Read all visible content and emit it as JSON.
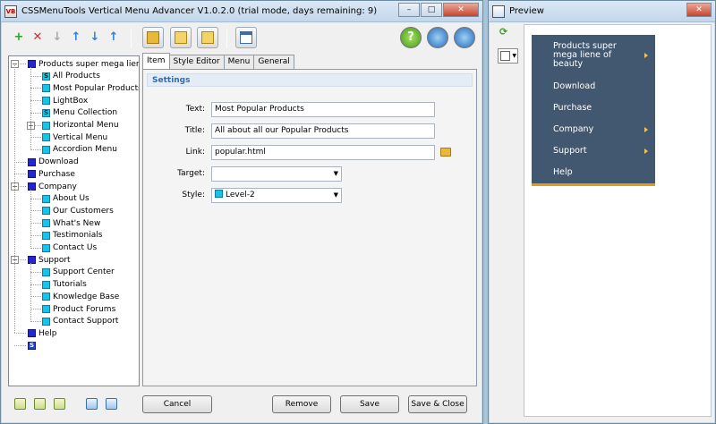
{
  "main": {
    "title": "CSSMenuTools Vertical Menu Advancer V1.0.2.0 (trial mode, days remaining: 9)",
    "app_icon_text": "VB"
  },
  "window_controls": {
    "minimize": "–",
    "maximize": "□",
    "close": "✕"
  },
  "toolbar": {
    "add": "+",
    "delete": "✕",
    "move_down_gray": "↓",
    "move_up": "↑",
    "move_down": "↓",
    "move_top": "↑",
    "help": "?"
  },
  "tree": {
    "items": [
      {
        "label": "Products super mega liene of",
        "icon": "dark",
        "level": 0,
        "expander": "−"
      },
      {
        "label": "All Products",
        "icon": "s2",
        "level": 1
      },
      {
        "label": "Most Popular Products",
        "icon": "cyan",
        "level": 1
      },
      {
        "label": "LightBox",
        "icon": "cyan",
        "level": 1
      },
      {
        "label": "Menu Collection",
        "icon": "s2",
        "level": 1
      },
      {
        "label": "Horizontal Menu",
        "icon": "cyan",
        "level": 1,
        "expander": "+"
      },
      {
        "label": "Vertical Menu",
        "icon": "cyan",
        "level": 1
      },
      {
        "label": "Accordion Menu",
        "icon": "cyan",
        "level": 1
      },
      {
        "label": "Download",
        "icon": "dark",
        "level": 0
      },
      {
        "label": "Purchase",
        "icon": "dark",
        "level": 0
      },
      {
        "label": "Company",
        "icon": "dark",
        "level": 0,
        "expander": "−"
      },
      {
        "label": "About Us",
        "icon": "cyan",
        "level": 1
      },
      {
        "label": "Our Customers",
        "icon": "cyan",
        "level": 1
      },
      {
        "label": "What's New",
        "icon": "cyan",
        "level": 1
      },
      {
        "label": "Testimonials",
        "icon": "cyan",
        "level": 1
      },
      {
        "label": "Contact Us",
        "icon": "cyan",
        "level": 1
      },
      {
        "label": "Support",
        "icon": "dark",
        "level": 0,
        "expander": "−"
      },
      {
        "label": "Support Center",
        "icon": "cyan",
        "level": 1
      },
      {
        "label": "Tutorials",
        "icon": "cyan",
        "level": 1
      },
      {
        "label": "Knowledge Base",
        "icon": "cyan",
        "level": 1
      },
      {
        "label": "Product Forums",
        "icon": "cyan",
        "level": 1
      },
      {
        "label": "Contact Support",
        "icon": "cyan",
        "level": 1
      },
      {
        "label": "Help",
        "icon": "dark",
        "level": 0
      },
      {
        "label": "",
        "icon": "s",
        "level": 0
      }
    ]
  },
  "tabs": [
    {
      "label": "Item",
      "active": true
    },
    {
      "label": "Style Editor"
    },
    {
      "label": "Menu"
    },
    {
      "label": "General"
    }
  ],
  "settings": {
    "header": "Settings",
    "text_label": "Text:",
    "text_value": "Most Popular Products",
    "title_label": "Title:",
    "title_value": "All about all  our Popular Products",
    "link_label": "Link:",
    "link_value": "popular.html",
    "target_label": "Target:",
    "target_value": "",
    "style_label": "Style:",
    "style_value": "Level-2"
  },
  "buttons": {
    "cancel": "Cancel",
    "remove": "Remove",
    "save": "Save",
    "save_close": "Save & Close"
  },
  "preview": {
    "title": "Preview",
    "menu": [
      {
        "label": "Products super mega liene of beauty",
        "arrow": true
      },
      {
        "label": "Download",
        "arrow": false
      },
      {
        "label": "Purchase",
        "arrow": false
      },
      {
        "label": "Company",
        "arrow": true
      },
      {
        "label": "Support",
        "arrow": true
      },
      {
        "label": "Help",
        "arrow": false
      }
    ]
  },
  "colors": {
    "menu_bg": "#425870",
    "menu_accent": "#e59a12",
    "settings_header": "#2a6fb6"
  }
}
